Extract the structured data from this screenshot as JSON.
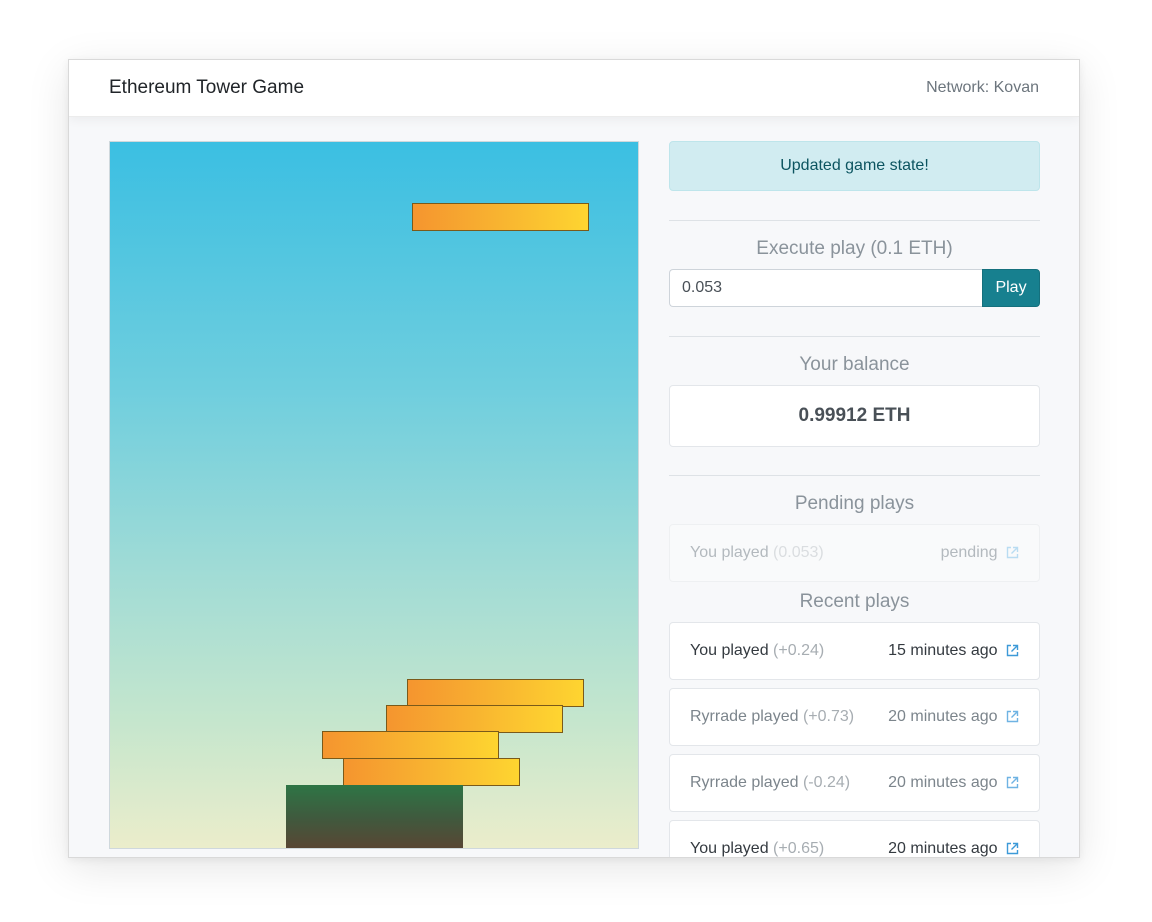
{
  "app": {
    "title": "Ethereum Tower Game",
    "network": "Network: Kovan"
  },
  "alert": "Updated game state!",
  "execute": {
    "title": "Execute play (0.1 ETH)",
    "amount_value": "0.053",
    "play_label": "Play"
  },
  "balance": {
    "title": "Your balance",
    "value": "0.99912 ETH"
  },
  "pending": {
    "title": "Pending plays",
    "items": [
      {
        "who": "You played",
        "delta": "(0.053)",
        "status": "pending"
      }
    ]
  },
  "recent": {
    "title": "Recent plays",
    "items": [
      {
        "who": "You played",
        "delta": "(+0.24)",
        "time": "15 minutes ago"
      },
      {
        "who": "Ryrrade played",
        "delta": "(+0.73)",
        "time": "20 minutes ago"
      },
      {
        "who": "Ryrrade played",
        "delta": "(-0.24)",
        "time": "20 minutes ago"
      },
      {
        "who": "You played",
        "delta": "(+0.65)",
        "time": "20 minutes ago"
      }
    ]
  },
  "colors": {
    "accent": "#17808f",
    "alert_bg": "#d1ecf1",
    "block_start": "#f5952f",
    "block_end": "#fed530",
    "link_icon": "#4aa3df"
  },
  "icons": {
    "external_link": "external-link-icon"
  }
}
